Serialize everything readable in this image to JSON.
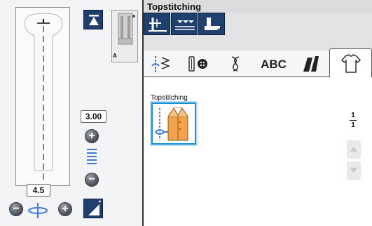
{
  "header": {
    "title": "Topstitching"
  },
  "left_panel": {
    "stitch_length": "3.00",
    "stitch_width": "4.5",
    "presser_foot_code": "A"
  },
  "tabs": [
    {
      "icon": "utility-stitch-icon"
    },
    {
      "icon": "buttonhole-icon"
    },
    {
      "icon": "decorative-stitch-icon"
    },
    {
      "label": "ABC",
      "icon": "alphabet-icon"
    },
    {
      "icon": "quilt-stitch-icon"
    },
    {
      "icon": "garment-icon"
    }
  ],
  "content": {
    "category_label": "Topstitching",
    "page_current": "1",
    "page_total": "1"
  },
  "colors": {
    "button_blue": "#1f3f6e",
    "selection_blue": "#1a8fd6",
    "garment_orange": "#f2a24a",
    "scale_blue": "#3a7bd5"
  }
}
